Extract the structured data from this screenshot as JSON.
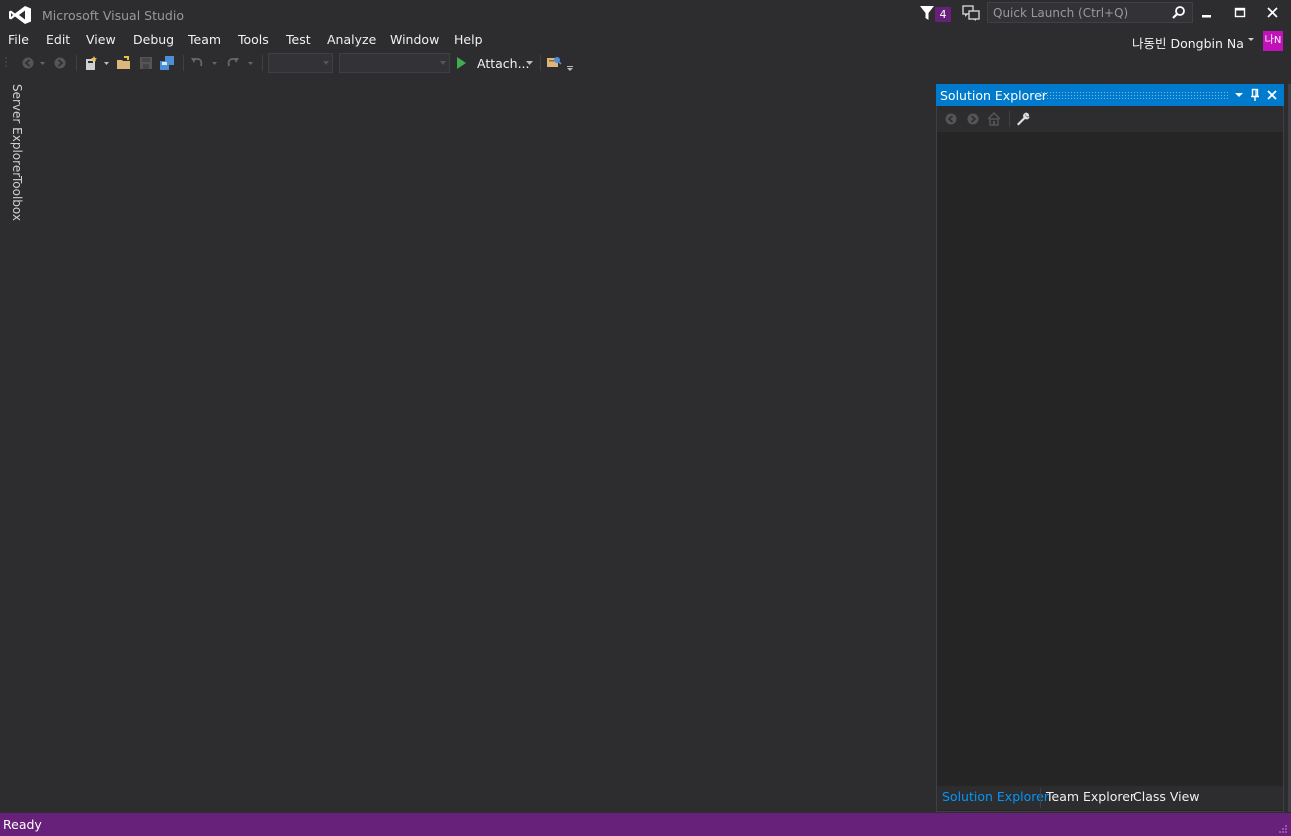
{
  "window": {
    "title": "Microsoft Visual Studio",
    "notification_count": "4"
  },
  "quick_launch": {
    "placeholder": "Quick Launch (Ctrl+Q)"
  },
  "menu": {
    "items": [
      "File",
      "Edit",
      "View",
      "Debug",
      "Team",
      "Tools",
      "Test",
      "Analyze",
      "Window",
      "Help"
    ]
  },
  "account": {
    "name": "나동빈 Dongbin Na",
    "initials": "나N"
  },
  "toolbar": {
    "attach_label": "Attach..."
  },
  "side_tabs": {
    "server_explorer": "Server Explorer",
    "toolbox": "Toolbox"
  },
  "solution_explorer": {
    "title": "Solution Explorer",
    "tabs": [
      "Solution Explorer",
      "Team Explorer",
      "Class View"
    ]
  },
  "status": {
    "text": "Ready"
  },
  "colors": {
    "background": "#2d2d30",
    "accent": "#007acc",
    "status_bar": "#68217a",
    "avatar": "#c012b8",
    "active_tab_text": "#0097fb"
  },
  "icons": {
    "logo": "visual-studio-logo-icon",
    "notification": "funnel-icon",
    "feedback": "feedback-icon",
    "search": "search-icon",
    "minimize": "minimize-icon",
    "maximize": "maximize-icon",
    "close": "close-icon"
  }
}
